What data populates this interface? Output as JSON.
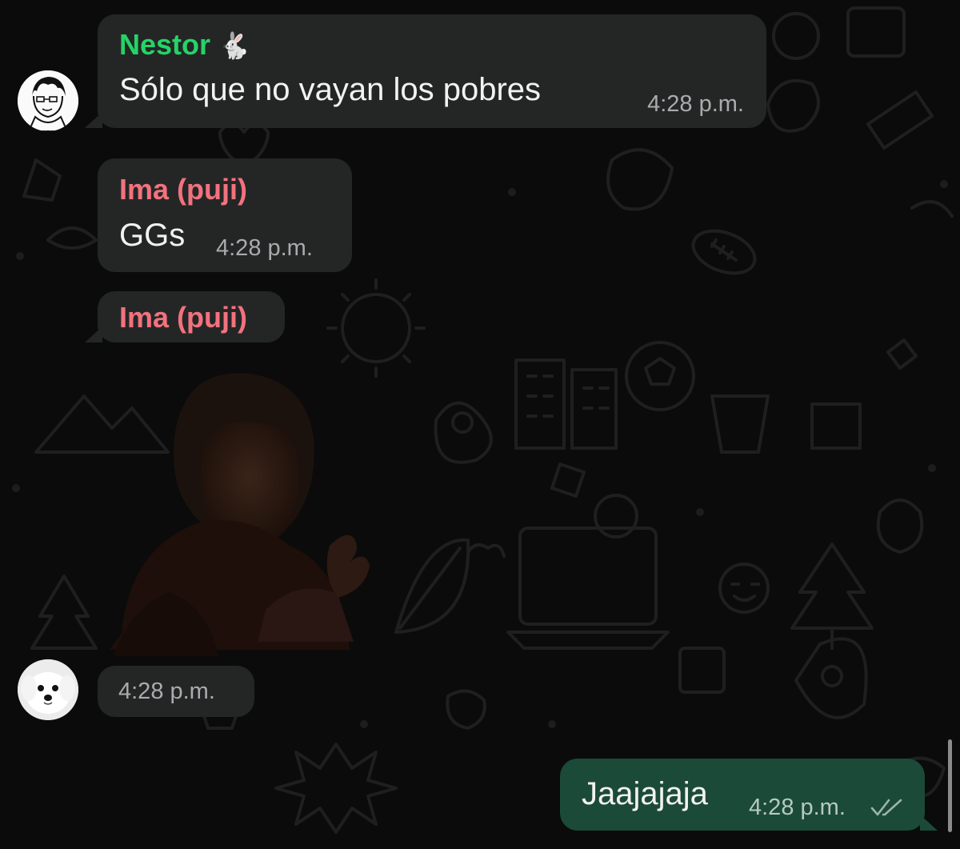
{
  "messages": [
    {
      "sender": "Nestor",
      "sender_emoji": "🐇",
      "sender_color": "#25d366",
      "text": "Sólo que no vayan los pobres",
      "time": "4:28 p.m.",
      "direction": "incoming"
    },
    {
      "sender": "Ima (puji)",
      "sender_color": "#f2727e",
      "text": "GGs",
      "time": "4:28 p.m.",
      "direction": "incoming"
    },
    {
      "sender": "Ima (puji)",
      "sender_color": "#f2727e",
      "type": "sticker",
      "time": "4:28 p.m.",
      "direction": "incoming"
    },
    {
      "text": "Jaajajaja",
      "time": "4:28 p.m.",
      "status_icon": "double-check-icon",
      "direction": "outgoing"
    }
  ],
  "colors": {
    "background": "#0b0b0b",
    "incoming_bubble": "#242626",
    "outgoing_bubble": "#1b4a38",
    "timestamp": "#a9acae"
  }
}
